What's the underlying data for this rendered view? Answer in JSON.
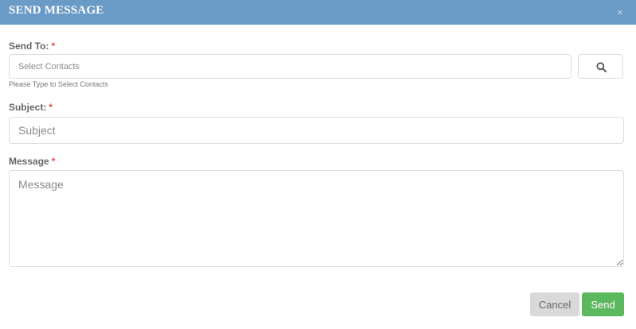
{
  "dialog": {
    "title": "SEND MESSAGE",
    "close_glyph": "×"
  },
  "form": {
    "send_to": {
      "label": "Send To:",
      "required_mark": "*",
      "placeholder": "Select Contacts",
      "hint": "Please Type to Select Contacts",
      "search_icon": "search-icon"
    },
    "subject": {
      "label": "Subject:",
      "required_mark": "*",
      "placeholder": "Subject"
    },
    "message": {
      "label": "Message",
      "required_mark": "*",
      "placeholder": "Message"
    }
  },
  "footer": {
    "cancel_label": "Cancel",
    "send_label": "Send"
  },
  "colors": {
    "header": "#6a9bc6",
    "send_button": "#5cb85c",
    "cancel_button": "#d9d9d9",
    "required": "#d9534f"
  }
}
